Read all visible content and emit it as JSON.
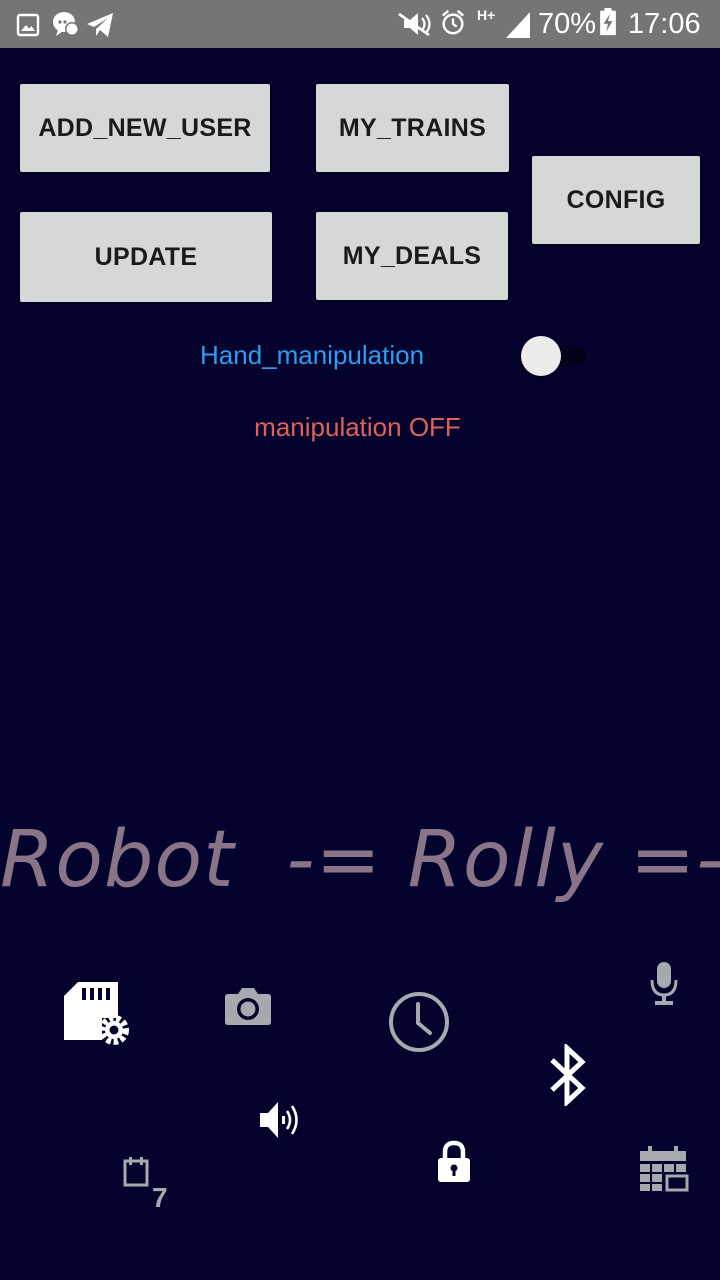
{
  "status_bar": {
    "battery": "70%",
    "time": "17:06",
    "network": "H+",
    "icons": [
      "gallery-icon",
      "chat-icon",
      "telegram-icon",
      "mute-icon",
      "alarm-icon",
      "signal-icon",
      "battery-charging-icon"
    ]
  },
  "buttons": {
    "add_new_user": "ADD_NEW_USER",
    "my_trains": "MY_TRAINS",
    "config": "CONFIG",
    "update": "UPDATE",
    "my_deals": "MY_DEALS"
  },
  "switch": {
    "label": "Hand_manipulation",
    "on": false
  },
  "status_text": "manipulation OFF",
  "title": "Robot  -= Rolly =-",
  "bottom_icons": [
    "sd-card-settings-icon",
    "camera-icon",
    "clock-icon",
    "microphone-icon",
    "bluetooth-icon",
    "speaker-icon",
    "calendar-7-icon",
    "lock-icon",
    "calendar-grid-icon"
  ],
  "calendar_number": "7",
  "colors": {
    "background": "#03032e",
    "status_bar": "#757575",
    "button_bg": "#d6d7d7",
    "switch_label": "#2f9cf0",
    "status_text": "#e0605a",
    "title": "#8a7487"
  }
}
